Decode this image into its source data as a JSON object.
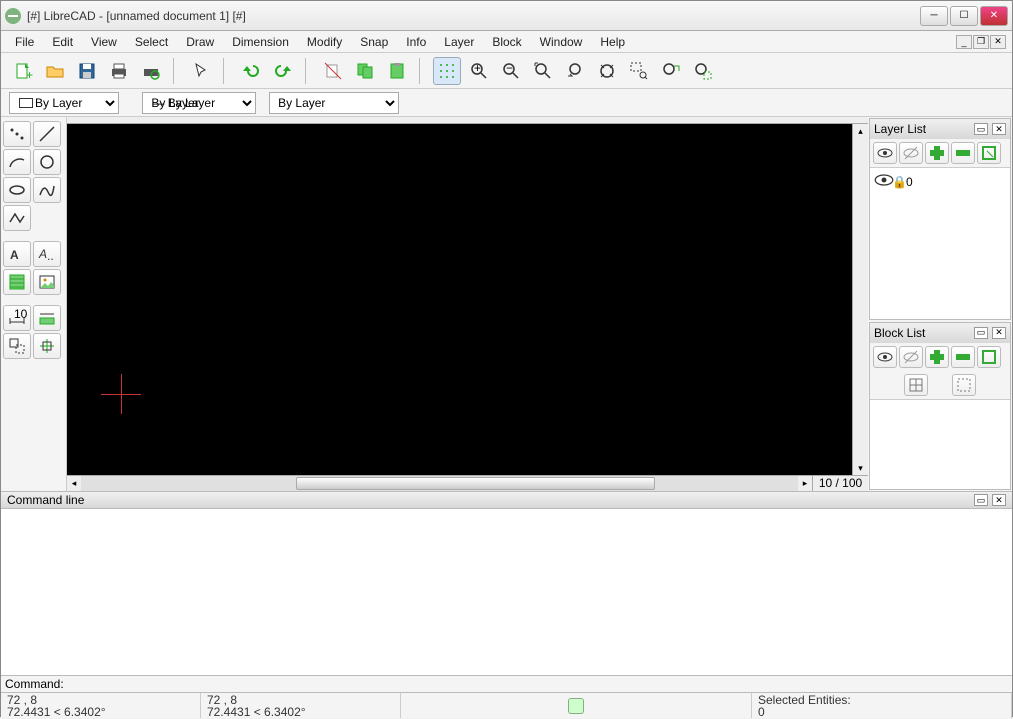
{
  "window": {
    "title": "[#] LibreCAD - [unnamed document 1] [#]"
  },
  "menu": {
    "items": [
      "File",
      "Edit",
      "View",
      "Select",
      "Draw",
      "Dimension",
      "Modify",
      "Snap",
      "Info",
      "Layer",
      "Block",
      "Window",
      "Help"
    ]
  },
  "properties": {
    "color_label": "By Layer",
    "width_label": "By Layer",
    "linetype_label": "By Layer"
  },
  "panels": {
    "layer_list": {
      "title": "Layer List",
      "layers": [
        {
          "name": "0",
          "visible": true,
          "locked": false
        }
      ]
    },
    "block_list": {
      "title": "Block List"
    }
  },
  "canvas": {
    "zoom": "10 / 100"
  },
  "command_line": {
    "title": "Command line",
    "prompt": "Command:"
  },
  "status": {
    "coord_abs": "72 , 8",
    "coord_polar": "72.4431 < 6.3402°",
    "coord_abs2": "72 , 8",
    "coord_polar2": "72.4431 < 6.3402°",
    "selected_label": "Selected Entities:",
    "selected_count": "0"
  }
}
